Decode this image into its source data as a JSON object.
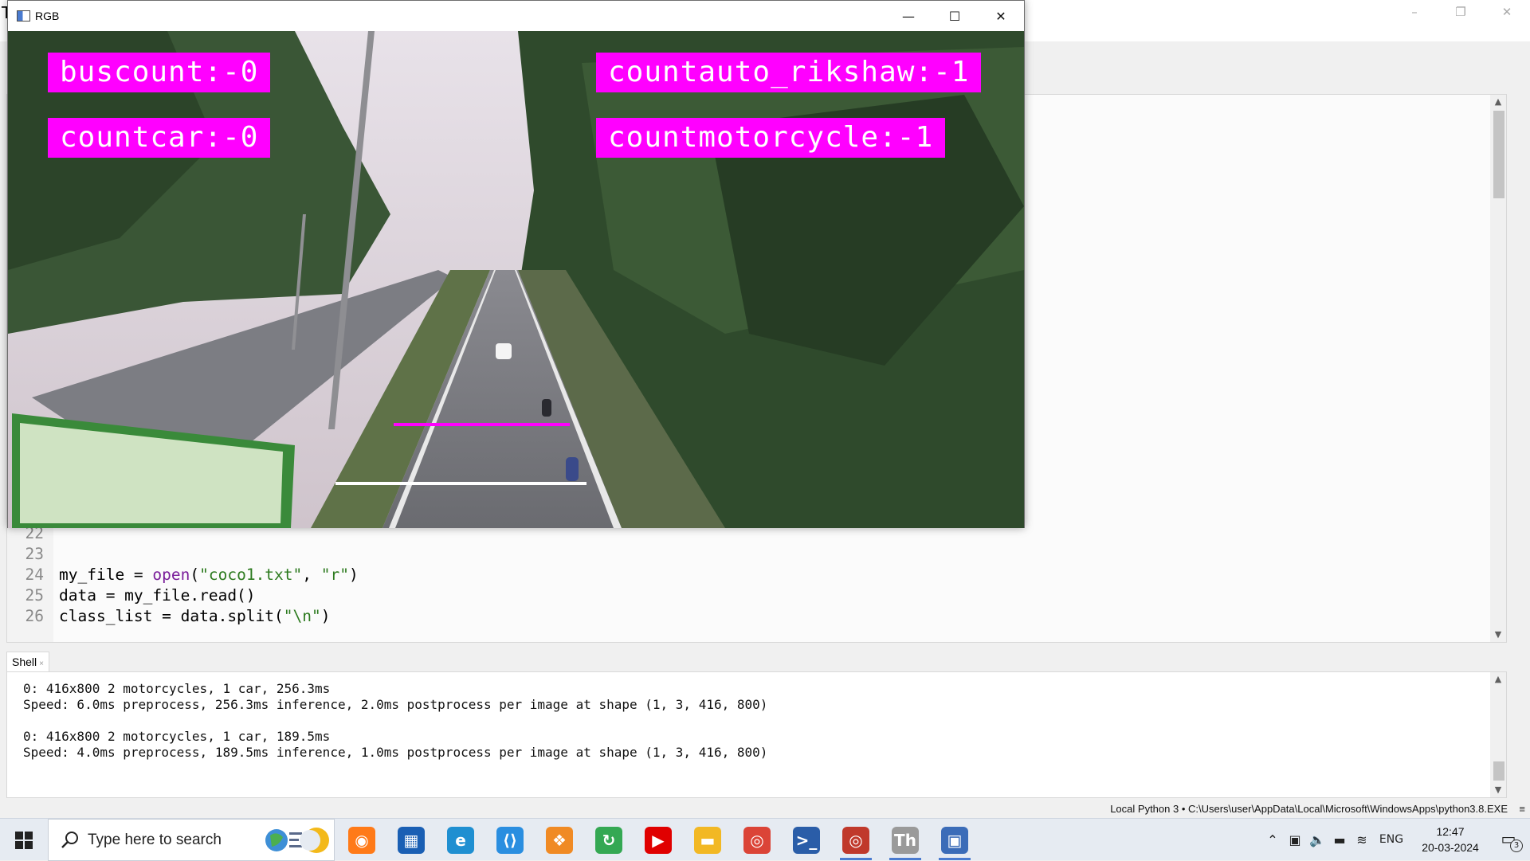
{
  "thonny": {
    "title_glyph": "T",
    "window_controls": {
      "minimize": "–",
      "restore": "❐",
      "close": "✕"
    },
    "editor": {
      "lines": [
        {
          "n": "22",
          "parts": []
        },
        {
          "n": "23",
          "parts": []
        },
        {
          "n": "24",
          "parts": [
            {
              "t": "my_file = ",
              "c": ""
            },
            {
              "t": "open",
              "c": "kw-fn"
            },
            {
              "t": "(",
              "c": ""
            },
            {
              "t": "\"coco1.txt\"",
              "c": "kw-str"
            },
            {
              "t": ", ",
              "c": ""
            },
            {
              "t": "\"r\"",
              "c": "kw-str"
            },
            {
              "t": ")",
              "c": ""
            }
          ]
        },
        {
          "n": "25",
          "parts": [
            {
              "t": "data = my_file.read()",
              "c": ""
            }
          ]
        },
        {
          "n": "26",
          "parts": [
            {
              "t": "class_list = data.split(",
              "c": ""
            },
            {
              "t": "\"\\n\"",
              "c": "kw-str"
            },
            {
              "t": ")",
              "c": ""
            }
          ]
        }
      ]
    },
    "shell": {
      "tab_label": "Shell",
      "tab_close": "×",
      "lines": [
        "0: 416x800 2 motorcycles, 1 car, 256.3ms",
        "Speed: 6.0ms preprocess, 256.3ms inference, 2.0ms postprocess per image at shape (1, 3, 416, 800)",
        "",
        "0: 416x800 2 motorcycles, 1 car, 189.5ms",
        "Speed: 4.0ms preprocess, 189.5ms inference, 1.0ms postprocess per image at shape (1, 3, 416, 800)"
      ]
    },
    "status": {
      "interpreter": "Local Python 3  •  C:\\Users\\user\\AppData\\Local\\Microsoft\\WindowsApps\\python3.8.EXE",
      "menu_glyph": "≡"
    }
  },
  "rgb_window": {
    "title": "RGB",
    "controls": {
      "minimize": "—",
      "maximize": "☐",
      "close": "✕"
    },
    "labels": {
      "bus": "buscount:-0",
      "car": "countcar:-0",
      "auto": "countauto_rikshaw:-1",
      "motorcycle": "countmotorcycle:-1"
    },
    "line_colors": {
      "upper": "#ff00ff",
      "lower": "#ffffff"
    }
  },
  "taskbar": {
    "search_placeholder": "Type here to search",
    "apps": [
      {
        "name": "firefox-icon",
        "glyph": "◉",
        "bg": "#ff7a18"
      },
      {
        "name": "store-icon",
        "glyph": "▦",
        "bg": "#1a5fb4"
      },
      {
        "name": "edge-icon",
        "glyph": "e",
        "bg": "#1f8fd1"
      },
      {
        "name": "vscode-icon",
        "glyph": "⟨⟩",
        "bg": "#2a8ee0"
      },
      {
        "name": "tool-icon",
        "glyph": "❖",
        "bg": "#f08a24"
      },
      {
        "name": "refresh-app-icon",
        "glyph": "↻",
        "bg": "#34a853"
      },
      {
        "name": "youtube-icon",
        "glyph": "▶",
        "bg": "#e00000"
      },
      {
        "name": "file-explorer-icon",
        "glyph": "▬",
        "bg": "#f2b824"
      },
      {
        "name": "chrome-icon",
        "glyph": "◎",
        "bg": "#db4437"
      },
      {
        "name": "powershell-icon",
        "glyph": ">_",
        "bg": "#2a5da8"
      },
      {
        "name": "chrome-profile-icon",
        "glyph": "◎",
        "bg": "#c0392b"
      },
      {
        "name": "thonny-icon",
        "glyph": "Th",
        "bg": "#9a9a9a"
      },
      {
        "name": "python-window-icon",
        "glyph": "▣",
        "bg": "#3b6cb8"
      }
    ],
    "tray": {
      "language": "ENG",
      "time": "12:47",
      "date": "20-03-2024",
      "notification_count": "3"
    }
  }
}
